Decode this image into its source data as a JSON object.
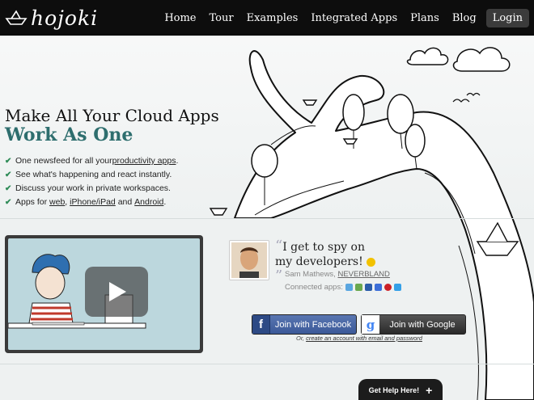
{
  "brand": {
    "logo_text": "hojoki"
  },
  "nav": {
    "items": [
      "Home",
      "Tour",
      "Examples",
      "Integrated Apps",
      "Plans",
      "Blog"
    ],
    "login": "Login"
  },
  "hero": {
    "title_line1": "Make All Your Cloud Apps",
    "title_line2": "Work As One",
    "features": [
      {
        "before": "One newsfeed for all your ",
        "link": "productivity apps",
        "after": "."
      },
      {
        "before": "See what's happening and react instantly.",
        "link": "",
        "after": ""
      },
      {
        "before": "Discuss your work in private workspaces.",
        "link": "",
        "after": ""
      },
      {
        "before": "Apps for ",
        "link": "web",
        "after": ", ",
        "link2": "iPhone/iPad",
        "mid": " and ",
        "link3": "Android",
        "end": "."
      }
    ]
  },
  "testimonial": {
    "quote": "I get to spy on my developers!",
    "author_name": "Sam Mathews, ",
    "author_company": "NEVERBLAND",
    "connected_label": "Connected apps:",
    "connected_icons": [
      "dropbox-icon",
      "evernote-icon",
      "calendar-icon",
      "docs-icon",
      "pinterest-icon",
      "twitter-icon"
    ]
  },
  "auth": {
    "facebook_label": "Join with Facebook",
    "google_label": "Join with Google",
    "create_prefix": "Or, ",
    "create_link": "create an account with email and password"
  },
  "help": {
    "label": "Get Help Here!",
    "plus": "+"
  },
  "colors": {
    "accent": "#2e6e6e",
    "facebook": "#3b5998",
    "topbar": "#0d0d0d"
  }
}
